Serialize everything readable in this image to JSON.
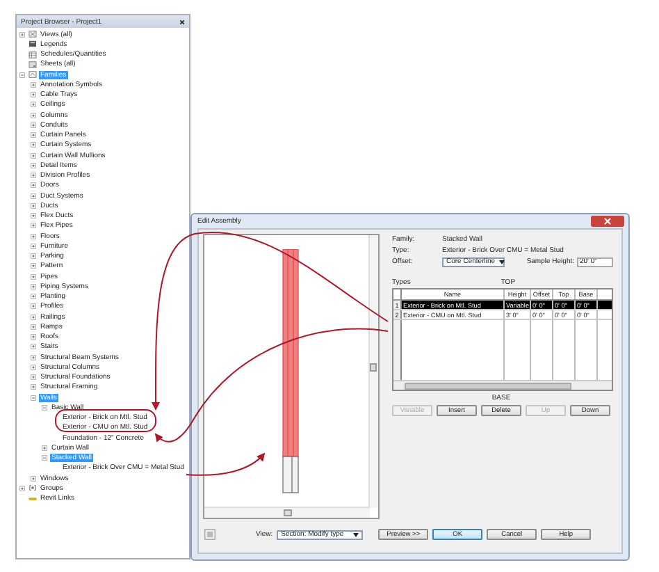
{
  "project_browser": {
    "title": "Project Browser - Project1",
    "tree": [
      {
        "label": "Views (all)",
        "kind": "views",
        "expanded": false,
        "selected": false
      },
      {
        "label": "Legends",
        "kind": "legends",
        "selected": false
      },
      {
        "label": "Schedules/Quantities",
        "kind": "schedules",
        "selected": false
      },
      {
        "label": "Sheets (all)",
        "kind": "sheets",
        "selected": false
      },
      {
        "label": "Families",
        "kind": "families",
        "expanded": true,
        "selected": true,
        "children": [
          {
            "label": "Annotation Symbols",
            "expanded": false,
            "selected": false
          },
          {
            "label": "Cable Trays",
            "expanded": false,
            "selected": false
          },
          {
            "label": "Ceilings",
            "expanded": false,
            "selected": false
          },
          {
            "label": "Columns",
            "expanded": false,
            "selected": false
          },
          {
            "label": "Conduits",
            "expanded": false,
            "selected": false
          },
          {
            "label": "Curtain Panels",
            "expanded": false,
            "selected": false
          },
          {
            "label": "Curtain Systems",
            "expanded": false,
            "selected": false
          },
          {
            "label": "Curtain Wall Mullions",
            "expanded": false,
            "selected": false
          },
          {
            "label": "Detail Items",
            "expanded": false,
            "selected": false
          },
          {
            "label": "Division Profiles",
            "expanded": false,
            "selected": false
          },
          {
            "label": "Doors",
            "expanded": false,
            "selected": false
          },
          {
            "label": "Duct Systems",
            "expanded": false,
            "selected": false
          },
          {
            "label": "Ducts",
            "expanded": false,
            "selected": false
          },
          {
            "label": "Flex Ducts",
            "expanded": false,
            "selected": false
          },
          {
            "label": "Flex Pipes",
            "expanded": false,
            "selected": false
          },
          {
            "label": "Floors",
            "expanded": false,
            "selected": false
          },
          {
            "label": "Furniture",
            "expanded": false,
            "selected": false
          },
          {
            "label": "Parking",
            "expanded": false,
            "selected": false
          },
          {
            "label": "Pattern",
            "expanded": false,
            "selected": false
          },
          {
            "label": "Pipes",
            "expanded": false,
            "selected": false
          },
          {
            "label": "Piping Systems",
            "expanded": false,
            "selected": false
          },
          {
            "label": "Planting",
            "expanded": false,
            "selected": false
          },
          {
            "label": "Profiles",
            "expanded": false,
            "selected": false
          },
          {
            "label": "Railings",
            "expanded": false,
            "selected": false
          },
          {
            "label": "Ramps",
            "expanded": false,
            "selected": false
          },
          {
            "label": "Roofs",
            "expanded": false,
            "selected": false
          },
          {
            "label": "Stairs",
            "expanded": false,
            "selected": false
          },
          {
            "label": "Structural Beam Systems",
            "expanded": false,
            "selected": false
          },
          {
            "label": "Structural Columns",
            "expanded": false,
            "selected": false
          },
          {
            "label": "Structural Foundations",
            "expanded": false,
            "selected": false
          },
          {
            "label": "Structural Framing",
            "expanded": false,
            "selected": false
          },
          {
            "label": "Walls",
            "expanded": true,
            "selected": true,
            "children": [
              {
                "label": "Basic Wall",
                "expanded": true,
                "selected": false,
                "children": [
                  {
                    "label": "Exterior - Brick on Mtl. Stud",
                    "selected": false
                  },
                  {
                    "label": "Exterior - CMU on Mtl. Stud",
                    "selected": false
                  },
                  {
                    "label": "Foundation - 12\" Concrete",
                    "selected": false
                  }
                ]
              },
              {
                "label": "Curtain Wall",
                "expanded": false,
                "selected": false
              },
              {
                "label": "Stacked Wall",
                "expanded": true,
                "selected": true,
                "children": [
                  {
                    "label": "Exterior - Brick Over CMU = Metal Stud",
                    "selected": false
                  }
                ]
              }
            ]
          },
          {
            "label": "Windows",
            "expanded": false,
            "selected": false
          }
        ]
      },
      {
        "label": "Groups",
        "kind": "groups",
        "expanded": false,
        "selected": false
      },
      {
        "label": "Revit Links",
        "kind": "links",
        "selected": false
      }
    ]
  },
  "dialog": {
    "title": "Edit Assembly",
    "fields": [
      {
        "label": "Family:",
        "value": "Stacked Wall"
      },
      {
        "label": "Type:",
        "value": "Exterior - Brick Over CMU = Metal Stud"
      }
    ],
    "offset_label": "Offset:",
    "offset": "Core Centerline",
    "sample_height_label": "Sample Height:",
    "sample_height": "20' 0\"",
    "types_label": "Types",
    "top_label": "TOP",
    "base_label": "BASE",
    "table": {
      "columns": [
        "Name",
        "Height",
        "Offset",
        "Top",
        "Base"
      ],
      "rows": [
        {
          "index": "1",
          "cells": [
            "Exterior - Brick on Mtl. Stud",
            "Variable",
            "0' 0\"",
            "0' 0\"",
            "0' 0\""
          ],
          "selected": true
        },
        {
          "index": "2",
          "cells": [
            "Exterior - CMU on Mtl. Stud",
            "3' 0\"",
            "0' 0\"",
            "0' 0\"",
            "0' 0\""
          ],
          "selected": false
        }
      ]
    },
    "buttons": [
      {
        "label": "Variable",
        "disabled": true
      },
      {
        "label": "Insert",
        "disabled": false
      },
      {
        "label": "Delete",
        "disabled": false
      },
      {
        "label": "Up",
        "disabled": true
      },
      {
        "label": "Down",
        "disabled": false
      }
    ],
    "view_label": "View:",
    "view": "Section: Modify type",
    "preview_button": "Preview >>",
    "footer_buttons": [
      {
        "label": "OK",
        "default": true
      },
      {
        "label": "Cancel",
        "default": false
      },
      {
        "label": "Help",
        "default": false
      }
    ]
  }
}
